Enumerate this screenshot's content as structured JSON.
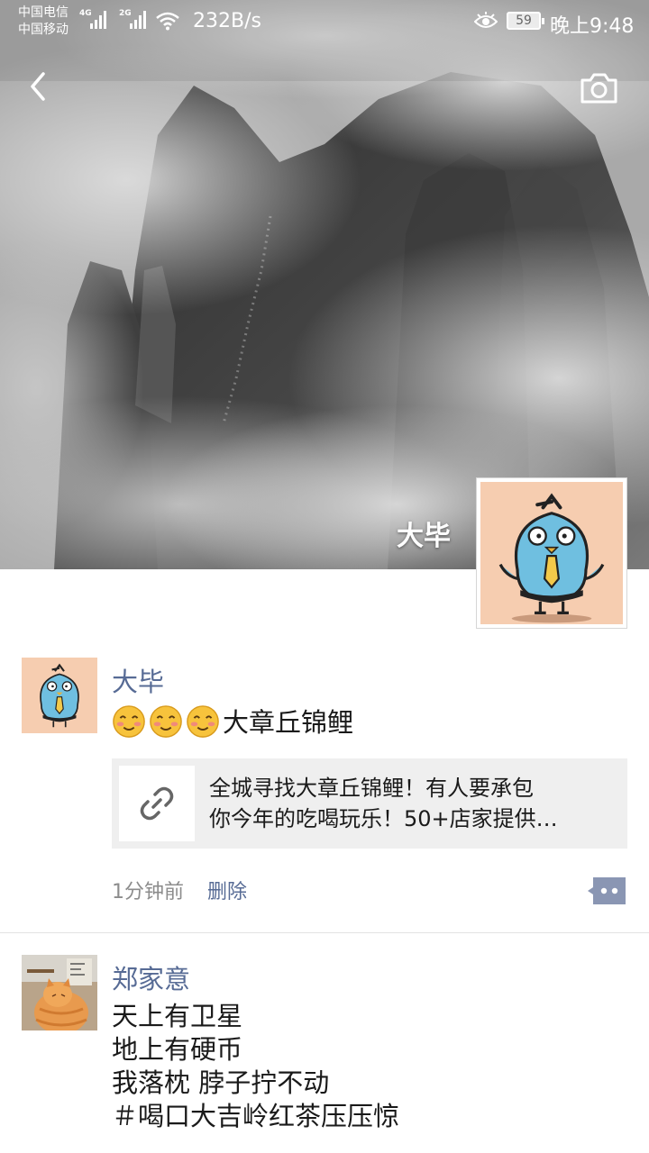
{
  "status_bar": {
    "carrier_1": "中国电信",
    "carrier_2": "中国移动",
    "network_1": "4G",
    "network_2": "2G",
    "speed": "232B/s",
    "battery": "59",
    "time": "晚上9:48",
    "icons": [
      "signal-icon",
      "wifi-icon",
      "eye-icon",
      "battery-icon"
    ]
  },
  "header": {
    "back_icon": "chevron-left-icon",
    "camera_icon": "camera-icon"
  },
  "cover": {
    "user_name": "大毕",
    "image_subject": "misty-mountain-photo"
  },
  "posts": [
    {
      "author": "大毕",
      "emoji_count": 3,
      "text": "大章丘锦鲤",
      "link": {
        "icon": "link-icon",
        "title_line_1": "全城寻找大章丘锦鲤！有人要承包",
        "title_line_2": "你今年的吃喝玩乐！50+店家提供…"
      },
      "time": "1分钟前",
      "delete_label": "删除",
      "comment_icon": "comment-icon"
    },
    {
      "author": "郑家意",
      "lines": [
        "天上有卫星",
        "地上有硬币",
        "我落枕 脖子拧不动",
        "＃喝口大吉岭红茶压压惊"
      ]
    }
  ],
  "colors": {
    "name_link": "#576b95",
    "link_card_bg": "#efefef",
    "divider": "#e3e3e3"
  }
}
